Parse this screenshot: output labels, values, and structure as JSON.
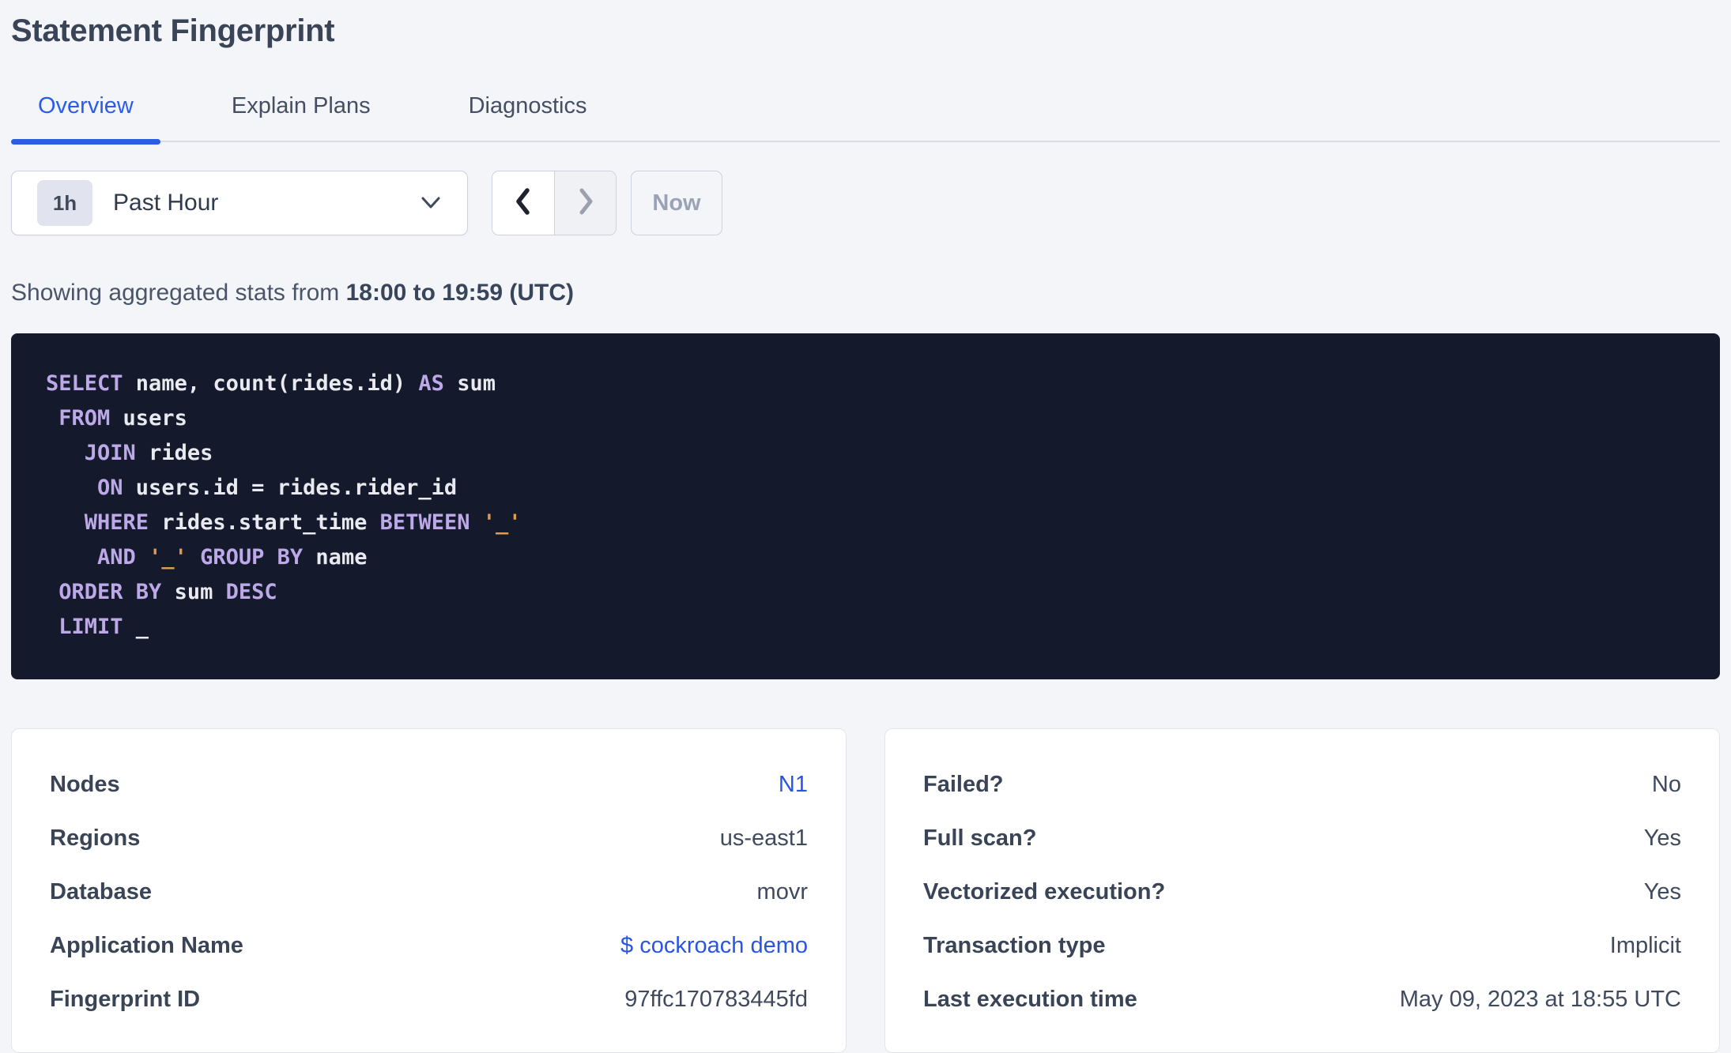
{
  "page": {
    "title": "Statement Fingerprint"
  },
  "tabs": [
    {
      "id": "overview",
      "label": "Overview",
      "active": true
    },
    {
      "id": "explain-plans",
      "label": "Explain Plans",
      "active": false
    },
    {
      "id": "diagnostics",
      "label": "Diagnostics",
      "active": false
    }
  ],
  "time_picker": {
    "badge": "1h",
    "selected_label": "Past Hour",
    "now_label": "Now",
    "prev_icon": "chevron-left-icon",
    "next_icon": "chevron-right-icon",
    "caret_icon": "chevron-down-icon"
  },
  "stats_line": {
    "prefix": "Showing aggregated stats from ",
    "range_bold": "18:00 to 19:59 (UTC)"
  },
  "sql": {
    "lines": [
      [
        {
          "t": "k",
          "v": "SELECT"
        },
        {
          "t": "p",
          "v": " name, count(rides.id) "
        },
        {
          "t": "k",
          "v": "AS"
        },
        {
          "t": "p",
          "v": " sum"
        }
      ],
      [
        {
          "t": "p",
          "v": " "
        },
        {
          "t": "k",
          "v": "FROM"
        },
        {
          "t": "p",
          "v": " users"
        }
      ],
      [
        {
          "t": "p",
          "v": "   "
        },
        {
          "t": "k",
          "v": "JOIN"
        },
        {
          "t": "p",
          "v": " rides"
        }
      ],
      [
        {
          "t": "p",
          "v": "    "
        },
        {
          "t": "k",
          "v": "ON"
        },
        {
          "t": "p",
          "v": " users.id = rides.rider_id"
        }
      ],
      [
        {
          "t": "p",
          "v": "   "
        },
        {
          "t": "k",
          "v": "WHERE"
        },
        {
          "t": "p",
          "v": " rides.start_time "
        },
        {
          "t": "k",
          "v": "BETWEEN"
        },
        {
          "t": "p",
          "v": " "
        },
        {
          "t": "s",
          "v": "'_'"
        }
      ],
      [
        {
          "t": "p",
          "v": "    "
        },
        {
          "t": "k",
          "v": "AND"
        },
        {
          "t": "p",
          "v": " "
        },
        {
          "t": "s",
          "v": "'_'"
        },
        {
          "t": "p",
          "v": " "
        },
        {
          "t": "k",
          "v": "GROUP BY"
        },
        {
          "t": "p",
          "v": " name"
        }
      ],
      [
        {
          "t": "p",
          "v": " "
        },
        {
          "t": "k",
          "v": "ORDER BY"
        },
        {
          "t": "p",
          "v": " sum "
        },
        {
          "t": "k",
          "v": "DESC"
        }
      ],
      [
        {
          "t": "p",
          "v": " "
        },
        {
          "t": "k",
          "v": "LIMIT"
        },
        {
          "t": "p",
          "v": " _"
        }
      ]
    ]
  },
  "cards": {
    "left": {
      "rows": [
        {
          "label": "Nodes",
          "value": "N1",
          "link": true
        },
        {
          "label": "Regions",
          "value": "us-east1",
          "link": false
        },
        {
          "label": "Database",
          "value": "movr",
          "link": false
        },
        {
          "label": "Application Name",
          "value": "$ cockroach demo",
          "link": true
        },
        {
          "label": "Fingerprint ID",
          "value": "97ffc170783445fd",
          "link": false
        }
      ]
    },
    "right": {
      "rows": [
        {
          "label": "Failed?",
          "value": "No",
          "link": false
        },
        {
          "label": "Full scan?",
          "value": "Yes",
          "link": false
        },
        {
          "label": "Vectorized execution?",
          "value": "Yes",
          "link": false
        },
        {
          "label": "Transaction type",
          "value": "Implicit",
          "link": false
        },
        {
          "label": "Last execution time",
          "value": "May 09, 2023 at 18:55 UTC",
          "link": false
        }
      ]
    }
  },
  "colors": {
    "page_background": "#f4f5f9",
    "accent_blue": "#2b5ce8",
    "link_blue": "#2b55e0",
    "code_background": "#141a2c",
    "code_keyword": "#bda9e8",
    "code_plain": "#e9eaef",
    "code_string": "#dd9c4e",
    "title_text": "#3a4457",
    "muted_text": "#9aa3b6"
  }
}
